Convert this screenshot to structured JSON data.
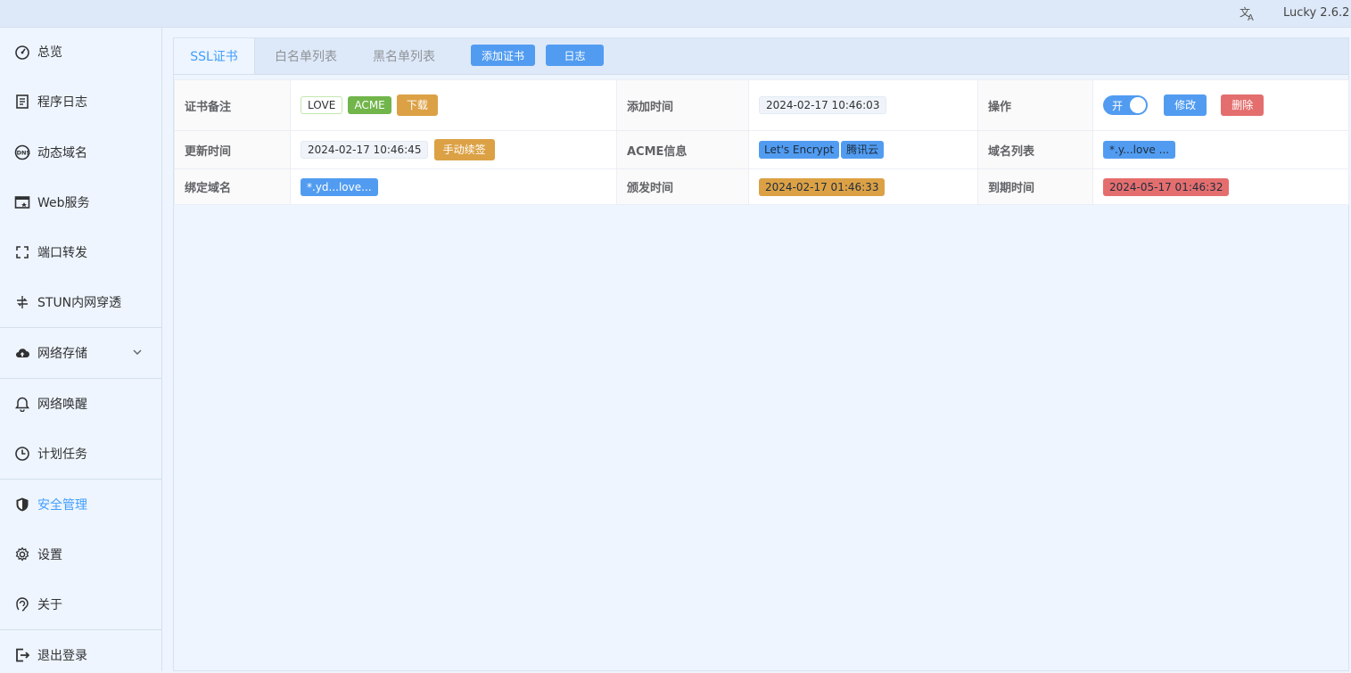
{
  "app": {
    "version": "Lucky 2.6.2",
    "lang_icon": "translate-icon"
  },
  "sidebar": {
    "items": [
      {
        "label": "总览",
        "icon": "dashboard-icon"
      },
      {
        "label": "程序日志",
        "icon": "log-icon"
      },
      {
        "label": "动态域名",
        "icon": "dns-icon"
      },
      {
        "label": "Web服务",
        "icon": "web-service-icon"
      },
      {
        "label": "端口转发",
        "icon": "port-forward-icon"
      },
      {
        "label": "STUN内网穿透",
        "icon": "stun-icon"
      },
      {
        "label": "网络存储",
        "icon": "cloud-storage-icon"
      },
      {
        "label": "网络唤醒",
        "icon": "bell-icon"
      },
      {
        "label": "计划任务",
        "icon": "clock-icon"
      },
      {
        "label": "安全管理",
        "icon": "shield-icon"
      },
      {
        "label": "设置",
        "icon": "gear-icon"
      },
      {
        "label": "关于",
        "icon": "about-icon"
      },
      {
        "label": "退出登录",
        "icon": "logout-icon"
      }
    ],
    "active": "安全管理"
  },
  "tabs": {
    "ssl": "SSL证书",
    "whitelist": "白名单列表",
    "blacklist": "黑名单列表",
    "add_cert": "添加证书",
    "log": "日志"
  },
  "cert": {
    "labels": {
      "note": "证书备注",
      "added_time": "添加时间",
      "operation": "操作",
      "updated_time": "更新时间",
      "acme_info": "ACME信息",
      "domain_list": "域名列表",
      "bound_domain": "绑定域名",
      "issued_time": "颁发时间",
      "expire_time": "到期时间"
    },
    "note_tag": "LOVE",
    "type_tag": "ACME",
    "download": "下载",
    "added_time": "2024-02-17 10:46:03",
    "switch_label": "开",
    "edit": "修改",
    "delete": "删除",
    "updated_time": "2024-02-17 10:46:45",
    "manual_renew": "手动续签",
    "acme_provider": "Let's Encrypt",
    "dns_provider": "腾讯云",
    "domain_list": "*.y...love ...",
    "bound_domain": "*.yd...love...",
    "issued_time": "2024-02-17 01:46:33",
    "expire_time": "2024-05-17 01:46:32"
  },
  "colors": {
    "accent": "#409eff",
    "blue_tag": "#519cf1",
    "orange_tag": "#dca145",
    "red_tag": "#e46e6e",
    "green_tag": "#71b54b"
  }
}
